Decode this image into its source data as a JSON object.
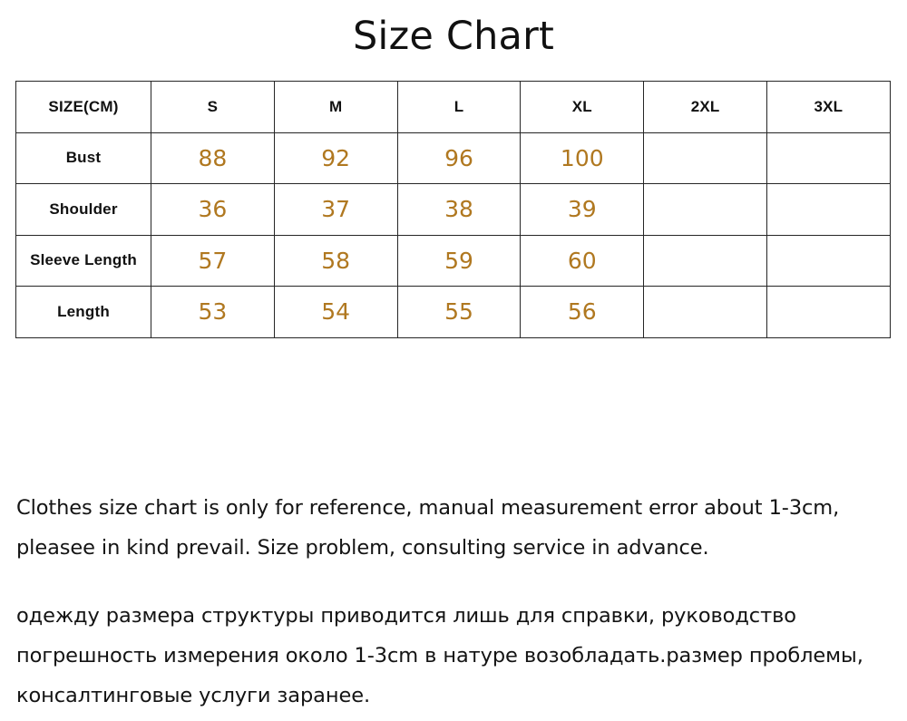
{
  "page": {
    "title": "Size Chart",
    "background_color": "#ffffff",
    "value_color": "#b07820",
    "header_color": "#111111",
    "border_color": "#262626"
  },
  "table": {
    "headers": [
      "SIZE(CM)",
      "S",
      "M",
      "L",
      "XL",
      "2XL",
      "3XL"
    ],
    "rows": [
      {
        "label": "Bust",
        "values": [
          "88",
          "92",
          "96",
          "100",
          "",
          ""
        ]
      },
      {
        "label": "Shoulder",
        "values": [
          "36",
          "37",
          "38",
          "39",
          "",
          ""
        ]
      },
      {
        "label": "Sleeve Length",
        "values": [
          "57",
          "58",
          "59",
          "60",
          "",
          ""
        ]
      },
      {
        "label": "Length",
        "values": [
          "53",
          "54",
          "55",
          "56",
          "",
          ""
        ]
      }
    ]
  },
  "notes": {
    "english": "Clothes size chart is only for reference, manual measurement error about 1-3cm, pleasee in kind prevail. Size problem, consulting service in advance.",
    "russian": "одежду размера структуры приводится лишь для справки, руководство погрешность измерения около 1-3cm в натуре возобладать.размер проблемы, консалтинговые услуги заранее."
  },
  "chart_data": {
    "type": "table",
    "title": "Size Chart",
    "unit": "CM",
    "categories": [
      "S",
      "M",
      "L",
      "XL",
      "2XL",
      "3XL"
    ],
    "series": [
      {
        "name": "Bust",
        "values": [
          88,
          92,
          96,
          100,
          null,
          null
        ]
      },
      {
        "name": "Shoulder",
        "values": [
          36,
          37,
          38,
          39,
          null,
          null
        ]
      },
      {
        "name": "Sleeve Length",
        "values": [
          57,
          58,
          59,
          60,
          null,
          null
        ]
      },
      {
        "name": "Length",
        "values": [
          53,
          54,
          55,
          56,
          null,
          null
        ]
      }
    ],
    "xlabel": "SIZE(CM)",
    "ylabel": "",
    "legend": []
  }
}
